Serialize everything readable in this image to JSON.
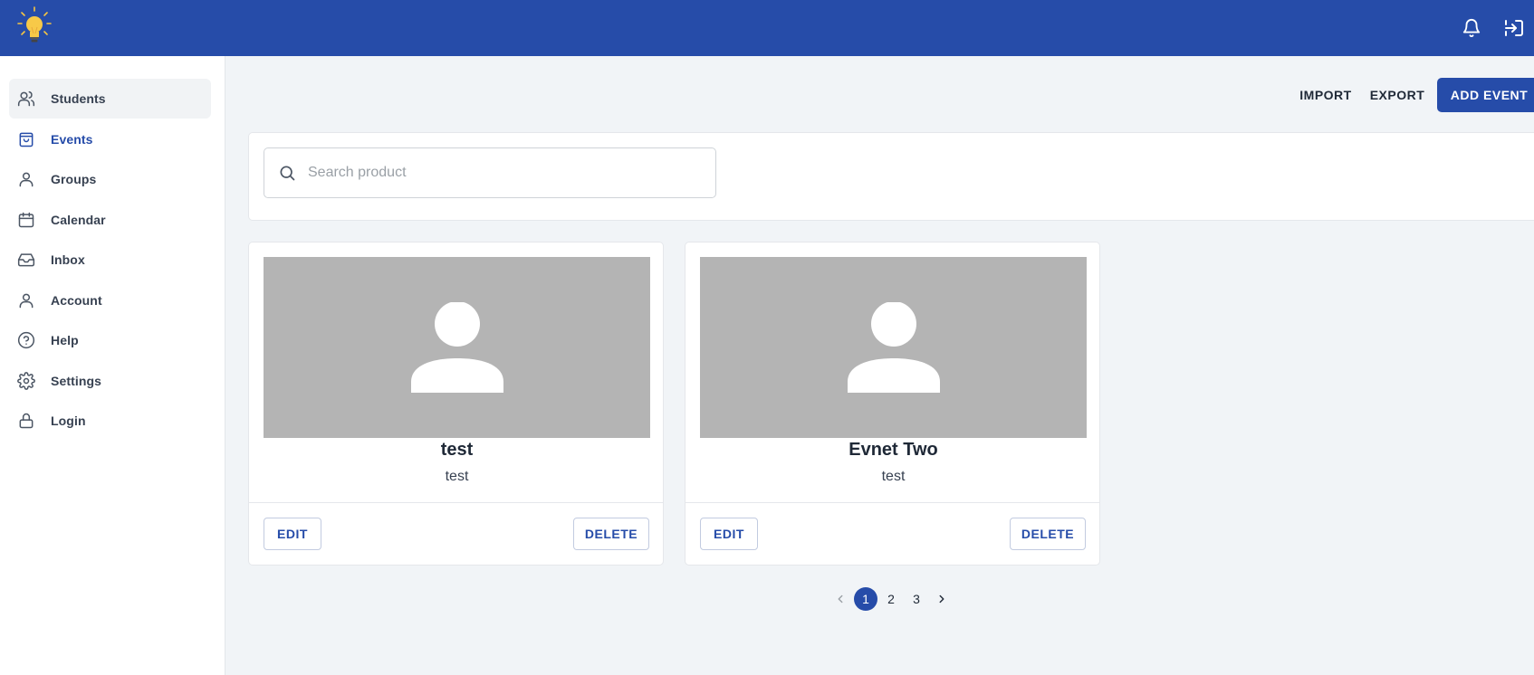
{
  "header": {
    "logo_icon": "lightbulb-icon",
    "notifications_icon": "bell-icon",
    "logout_icon": "exit-icon",
    "brand_color": "#264ca9"
  },
  "sidebar": {
    "items": [
      {
        "label": "Students",
        "icon": "users-icon"
      },
      {
        "label": "Events",
        "icon": "shopping-bag-icon"
      },
      {
        "label": "Groups",
        "icon": "user-icon"
      },
      {
        "label": "Calendar",
        "icon": "calendar-icon"
      },
      {
        "label": "Inbox",
        "icon": "inbox-icon"
      },
      {
        "label": "Account",
        "icon": "user-icon"
      },
      {
        "label": "Help",
        "icon": "help-circle-icon"
      },
      {
        "label": "Settings",
        "icon": "gear-icon"
      },
      {
        "label": "Login",
        "icon": "lock-icon"
      }
    ]
  },
  "toolbar": {
    "import_label": "IMPORT",
    "export_label": "EXPORT",
    "add_label": "ADD EVENT"
  },
  "search": {
    "placeholder": "Search product",
    "value": ""
  },
  "events": [
    {
      "title": "test",
      "subtitle": "test",
      "edit_label": "EDIT",
      "delete_label": "DELETE"
    },
    {
      "title": "Evnet Two",
      "subtitle": "test",
      "edit_label": "EDIT",
      "delete_label": "DELETE"
    }
  ],
  "pagination": {
    "pages": [
      "1",
      "2",
      "3"
    ],
    "current": "1"
  }
}
